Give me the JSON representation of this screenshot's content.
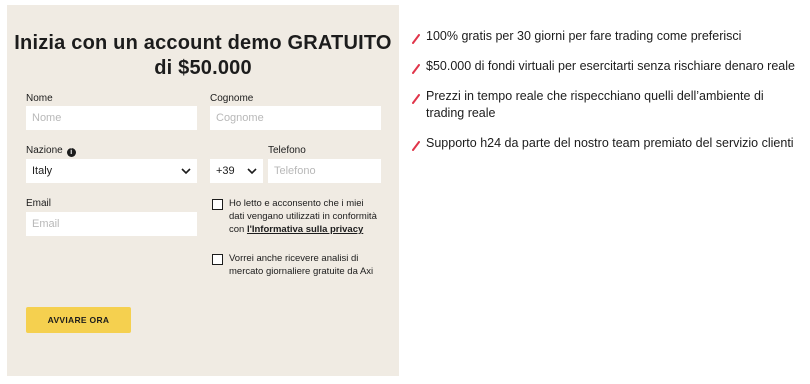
{
  "form": {
    "title_line1": "Inizia con un account demo GRATUITO",
    "title_line2": "di $50.000",
    "nome_label": "Nome",
    "nome_placeholder": "Nome",
    "cognome_label": "Cognome",
    "cognome_placeholder": "Cognome",
    "nazione_label": "Nazione",
    "nazione_value": "Italy",
    "prefix_value": "+39",
    "telefono_label": "Telefono",
    "telefono_placeholder": "Telefono",
    "email_label": "Email",
    "email_placeholder": "Email",
    "consent_text": "Ho letto e acconsento che i miei dati vengano utilizzati in conformità con ",
    "consent_link": "l'Informativa sulla privacy",
    "marketing_text": "Vorrei anche ricevere analisi di mercato giornaliere gratuite da Axi",
    "submit_label": "AVVIARE ORA"
  },
  "benefits": [
    {
      "text": "100% gratis per 30 giorni per fare trading come preferisci"
    },
    {
      "text": "$50.000 di fondi virtuali per esercitarti senza rischiare denaro reale"
    },
    {
      "text": "Prezzi in tempo reale che rispecchiano quelli dell’ambiente di trading reale"
    },
    {
      "text": "Supporto h24 da parte del nostro team premiato del servizio clienti"
    }
  ],
  "colors": {
    "panel_bg": "#f0ebe3",
    "button_bg": "#f5d04f",
    "accent_slash": "#e0354a"
  },
  "icons": {
    "bullet": "slash-icon",
    "info": "info-icon",
    "dropdown": "chevron-down-icon"
  }
}
